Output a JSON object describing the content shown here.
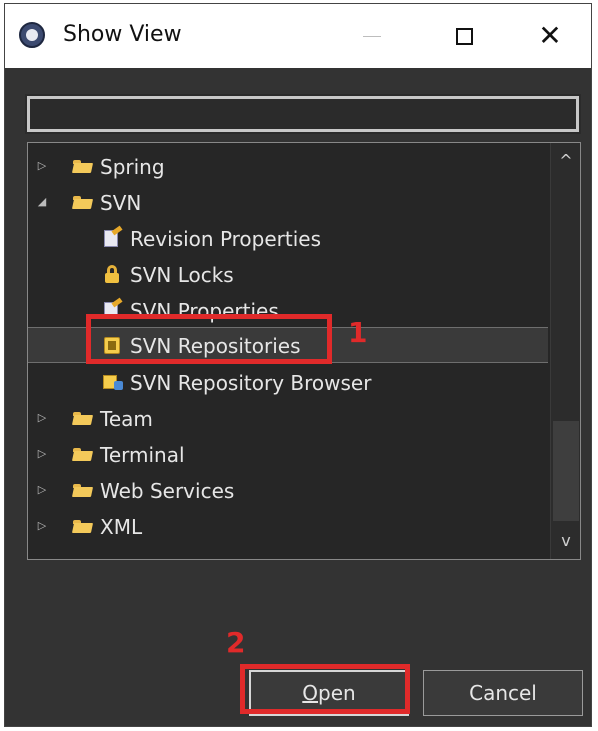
{
  "window": {
    "title": "Show View",
    "icon": "eclipse-app-icon",
    "controls": {
      "minimize": "—",
      "maximize": "☐",
      "close": "✕"
    }
  },
  "filter": {
    "value": "",
    "placeholder": ""
  },
  "tree": {
    "items": [
      {
        "label": "Spring",
        "level": 0,
        "expanded": false,
        "icon": "folder-icon",
        "selected": false
      },
      {
        "label": "SVN",
        "level": 0,
        "expanded": true,
        "icon": "folder-icon",
        "selected": false
      },
      {
        "label": "Revision Properties",
        "level": 1,
        "icon": "properties-icon",
        "selected": false
      },
      {
        "label": "SVN Locks",
        "level": 1,
        "icon": "lock-icon",
        "selected": false
      },
      {
        "label": "SVN Properties",
        "level": 1,
        "icon": "properties-icon",
        "selected": false
      },
      {
        "label": "SVN Repositories",
        "level": 1,
        "icon": "repository-icon",
        "selected": true
      },
      {
        "label": "SVN Repository Browser",
        "level": 1,
        "icon": "repository-browser-icon",
        "selected": false
      },
      {
        "label": "Team",
        "level": 0,
        "expanded": false,
        "icon": "folder-icon",
        "selected": false
      },
      {
        "label": "Terminal",
        "level": 0,
        "expanded": false,
        "icon": "folder-icon",
        "selected": false
      },
      {
        "label": "Web Services",
        "level": 0,
        "expanded": false,
        "icon": "folder-icon",
        "selected": false
      },
      {
        "label": "XML",
        "level": 0,
        "expanded": false,
        "icon": "folder-icon",
        "selected": false
      }
    ],
    "twisty_collapsed": "▷",
    "twisty_expanded": "◢"
  },
  "scrollbar": {
    "up": "^",
    "down": "v"
  },
  "annotations": {
    "marker_1": "1",
    "marker_2": "2",
    "color": "#e02a2a"
  },
  "buttons": {
    "open": {
      "mnemonic": "O",
      "rest": "pen"
    },
    "cancel": "Cancel"
  }
}
